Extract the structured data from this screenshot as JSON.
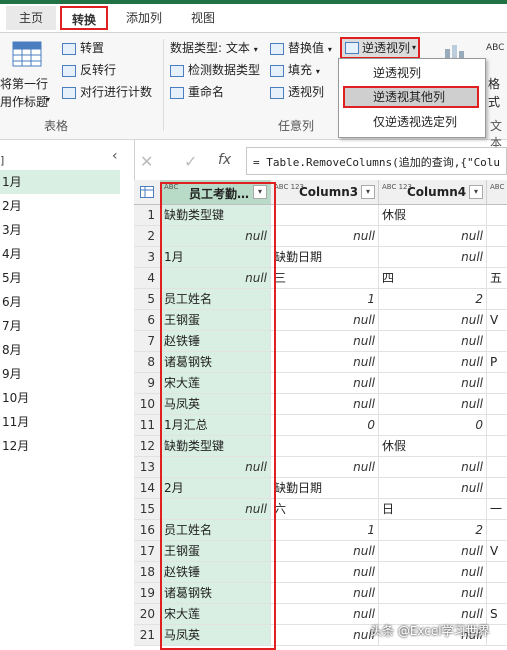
{
  "tabs": [
    "主页",
    "转换",
    "添加列",
    "视图"
  ],
  "ribbon": {
    "use_first_row_line1": "将第一行",
    "use_first_row_line2": "用作标题",
    "transpose": "转置",
    "reverse_rows": "反转行",
    "count_rows": "对行进行计数",
    "table_group": "表格",
    "data_type": "数据类型: 文本",
    "detect_type": "检测数据类型",
    "rename": "重命名",
    "replace_values": "替换值",
    "fill": "填充",
    "pivot_column": "透视列",
    "unpivot_columns": "逆透视列",
    "any_column_group": "任意列",
    "text_group": "文本",
    "format_label": "格",
    "format_label2": "式"
  },
  "dropdown": {
    "items": [
      "逆透视列",
      "逆透视其他列",
      "仅逆透视选定列"
    ]
  },
  "query_pane": {
    "items": [
      "1月",
      "2月",
      "3月",
      "4月",
      "5月",
      "6月",
      "7月",
      "8月",
      "9月",
      "10月",
      "11月",
      "12月"
    ]
  },
  "formula": {
    "text": "= Table.RemoveColumns(追加的查询,{\"Colu"
  },
  "grid": {
    "columns": [
      {
        "type": "ABC",
        "name": "员工考勤…"
      },
      {
        "type": "ABC 123",
        "name": "Column3"
      },
      {
        "type": "ABC 123",
        "name": "Column4"
      },
      {
        "type": "ABC 123",
        "name": ""
      }
    ],
    "rows": [
      [
        "1",
        "缺勤类型键",
        "",
        "休假",
        ""
      ],
      [
        "2",
        "null",
        "null",
        "null",
        ""
      ],
      [
        "3",
        "1月",
        "缺勤日期",
        "null",
        ""
      ],
      [
        "4",
        "null",
        "三",
        "四",
        "五"
      ],
      [
        "5",
        "员工姓名",
        "1",
        "2",
        "3"
      ],
      [
        "6",
        "王钢蛋",
        "null",
        "null",
        "V"
      ],
      [
        "7",
        "赵铁锤",
        "null",
        "null",
        ""
      ],
      [
        "8",
        "诸葛钢铁",
        "null",
        "null",
        "P"
      ],
      [
        "9",
        "宋大莲",
        "null",
        "null",
        ""
      ],
      [
        "10",
        "马凤英",
        "null",
        "null",
        ""
      ],
      [
        "11",
        "1月汇总",
        "0",
        "0",
        ""
      ],
      [
        "12",
        "缺勤类型键",
        "",
        "休假",
        ""
      ],
      [
        "13",
        "null",
        "null",
        "null",
        ""
      ],
      [
        "14",
        "2月",
        "缺勤日期",
        "null",
        ""
      ],
      [
        "15",
        "null",
        "六",
        "日",
        "一"
      ],
      [
        "16",
        "员工姓名",
        "1",
        "2",
        "3"
      ],
      [
        "17",
        "王钢蛋",
        "null",
        "null",
        "V"
      ],
      [
        "18",
        "赵铁锤",
        "null",
        "null",
        ""
      ],
      [
        "19",
        "诸葛钢铁",
        "null",
        "null",
        ""
      ],
      [
        "20",
        "宋大莲",
        "null",
        "null",
        "S"
      ],
      [
        "21",
        "马凤英",
        "null",
        "null",
        ""
      ]
    ]
  },
  "watermark": "头条 @Excel学习世界"
}
